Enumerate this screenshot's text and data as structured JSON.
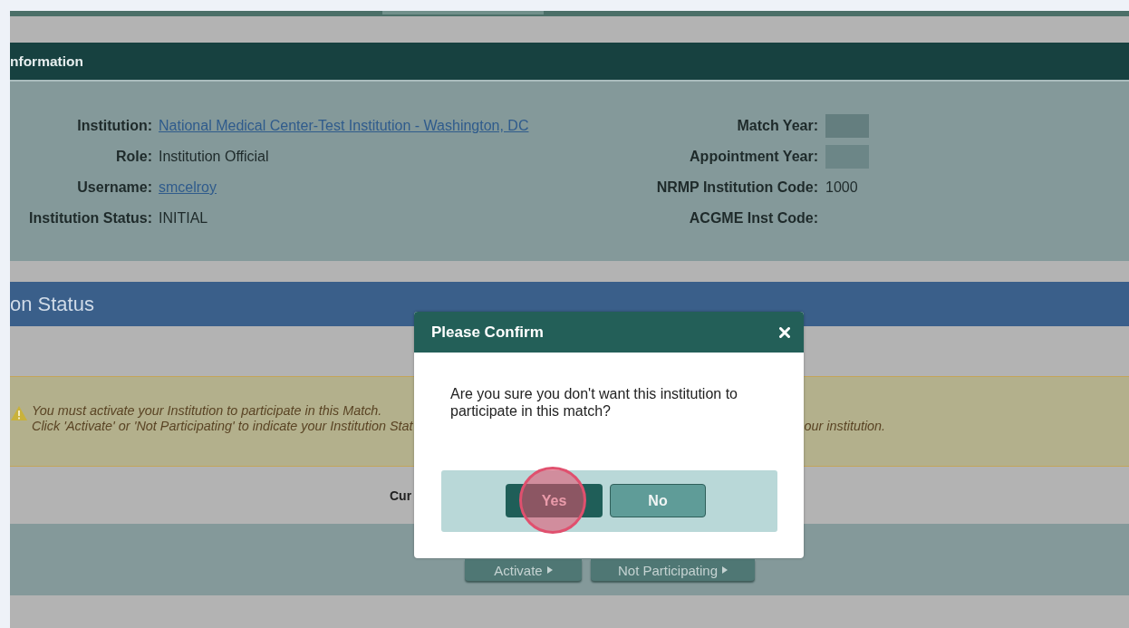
{
  "info_section": {
    "title": "nformation",
    "left_fields": [
      {
        "label": "Institution:",
        "value": "National Medical Center-Test Institution - Washington, DC",
        "kind": "link"
      },
      {
        "label": "Role:",
        "value": "Institution Official",
        "kind": "text"
      },
      {
        "label": "Username:",
        "value": "smcelroy",
        "kind": "link"
      },
      {
        "label": "Institution Status:",
        "value": "INITIAL",
        "kind": "text"
      }
    ],
    "right_fields": [
      {
        "label": "Match Year:",
        "kind": "hidden"
      },
      {
        "label": "Appointment Year:",
        "kind": "hidden"
      },
      {
        "label": "NRMP Institution Code:",
        "value": "1000",
        "kind": "text"
      },
      {
        "label": "ACGME Inst Code:",
        "kind": "empty"
      }
    ]
  },
  "status_section": {
    "title": "on Status",
    "alert_line_1": "You must activate your Institution to participate in this Match.",
    "alert_line_2_parts": [
      "Click 'Activate' or 'Not Participating' to indicate your Institution Stat",
      "our institution."
    ],
    "current_label": "Cur",
    "buttons": [
      "Activate",
      "Not Participating"
    ]
  },
  "dialog": {
    "title": "Please Confirm",
    "message": "Are you sure you don't want this institution to participate in this match?",
    "buttons": [
      {
        "label": "Yes",
        "kind": "primary"
      },
      {
        "label": "No",
        "kind": "secondary"
      }
    ]
  }
}
